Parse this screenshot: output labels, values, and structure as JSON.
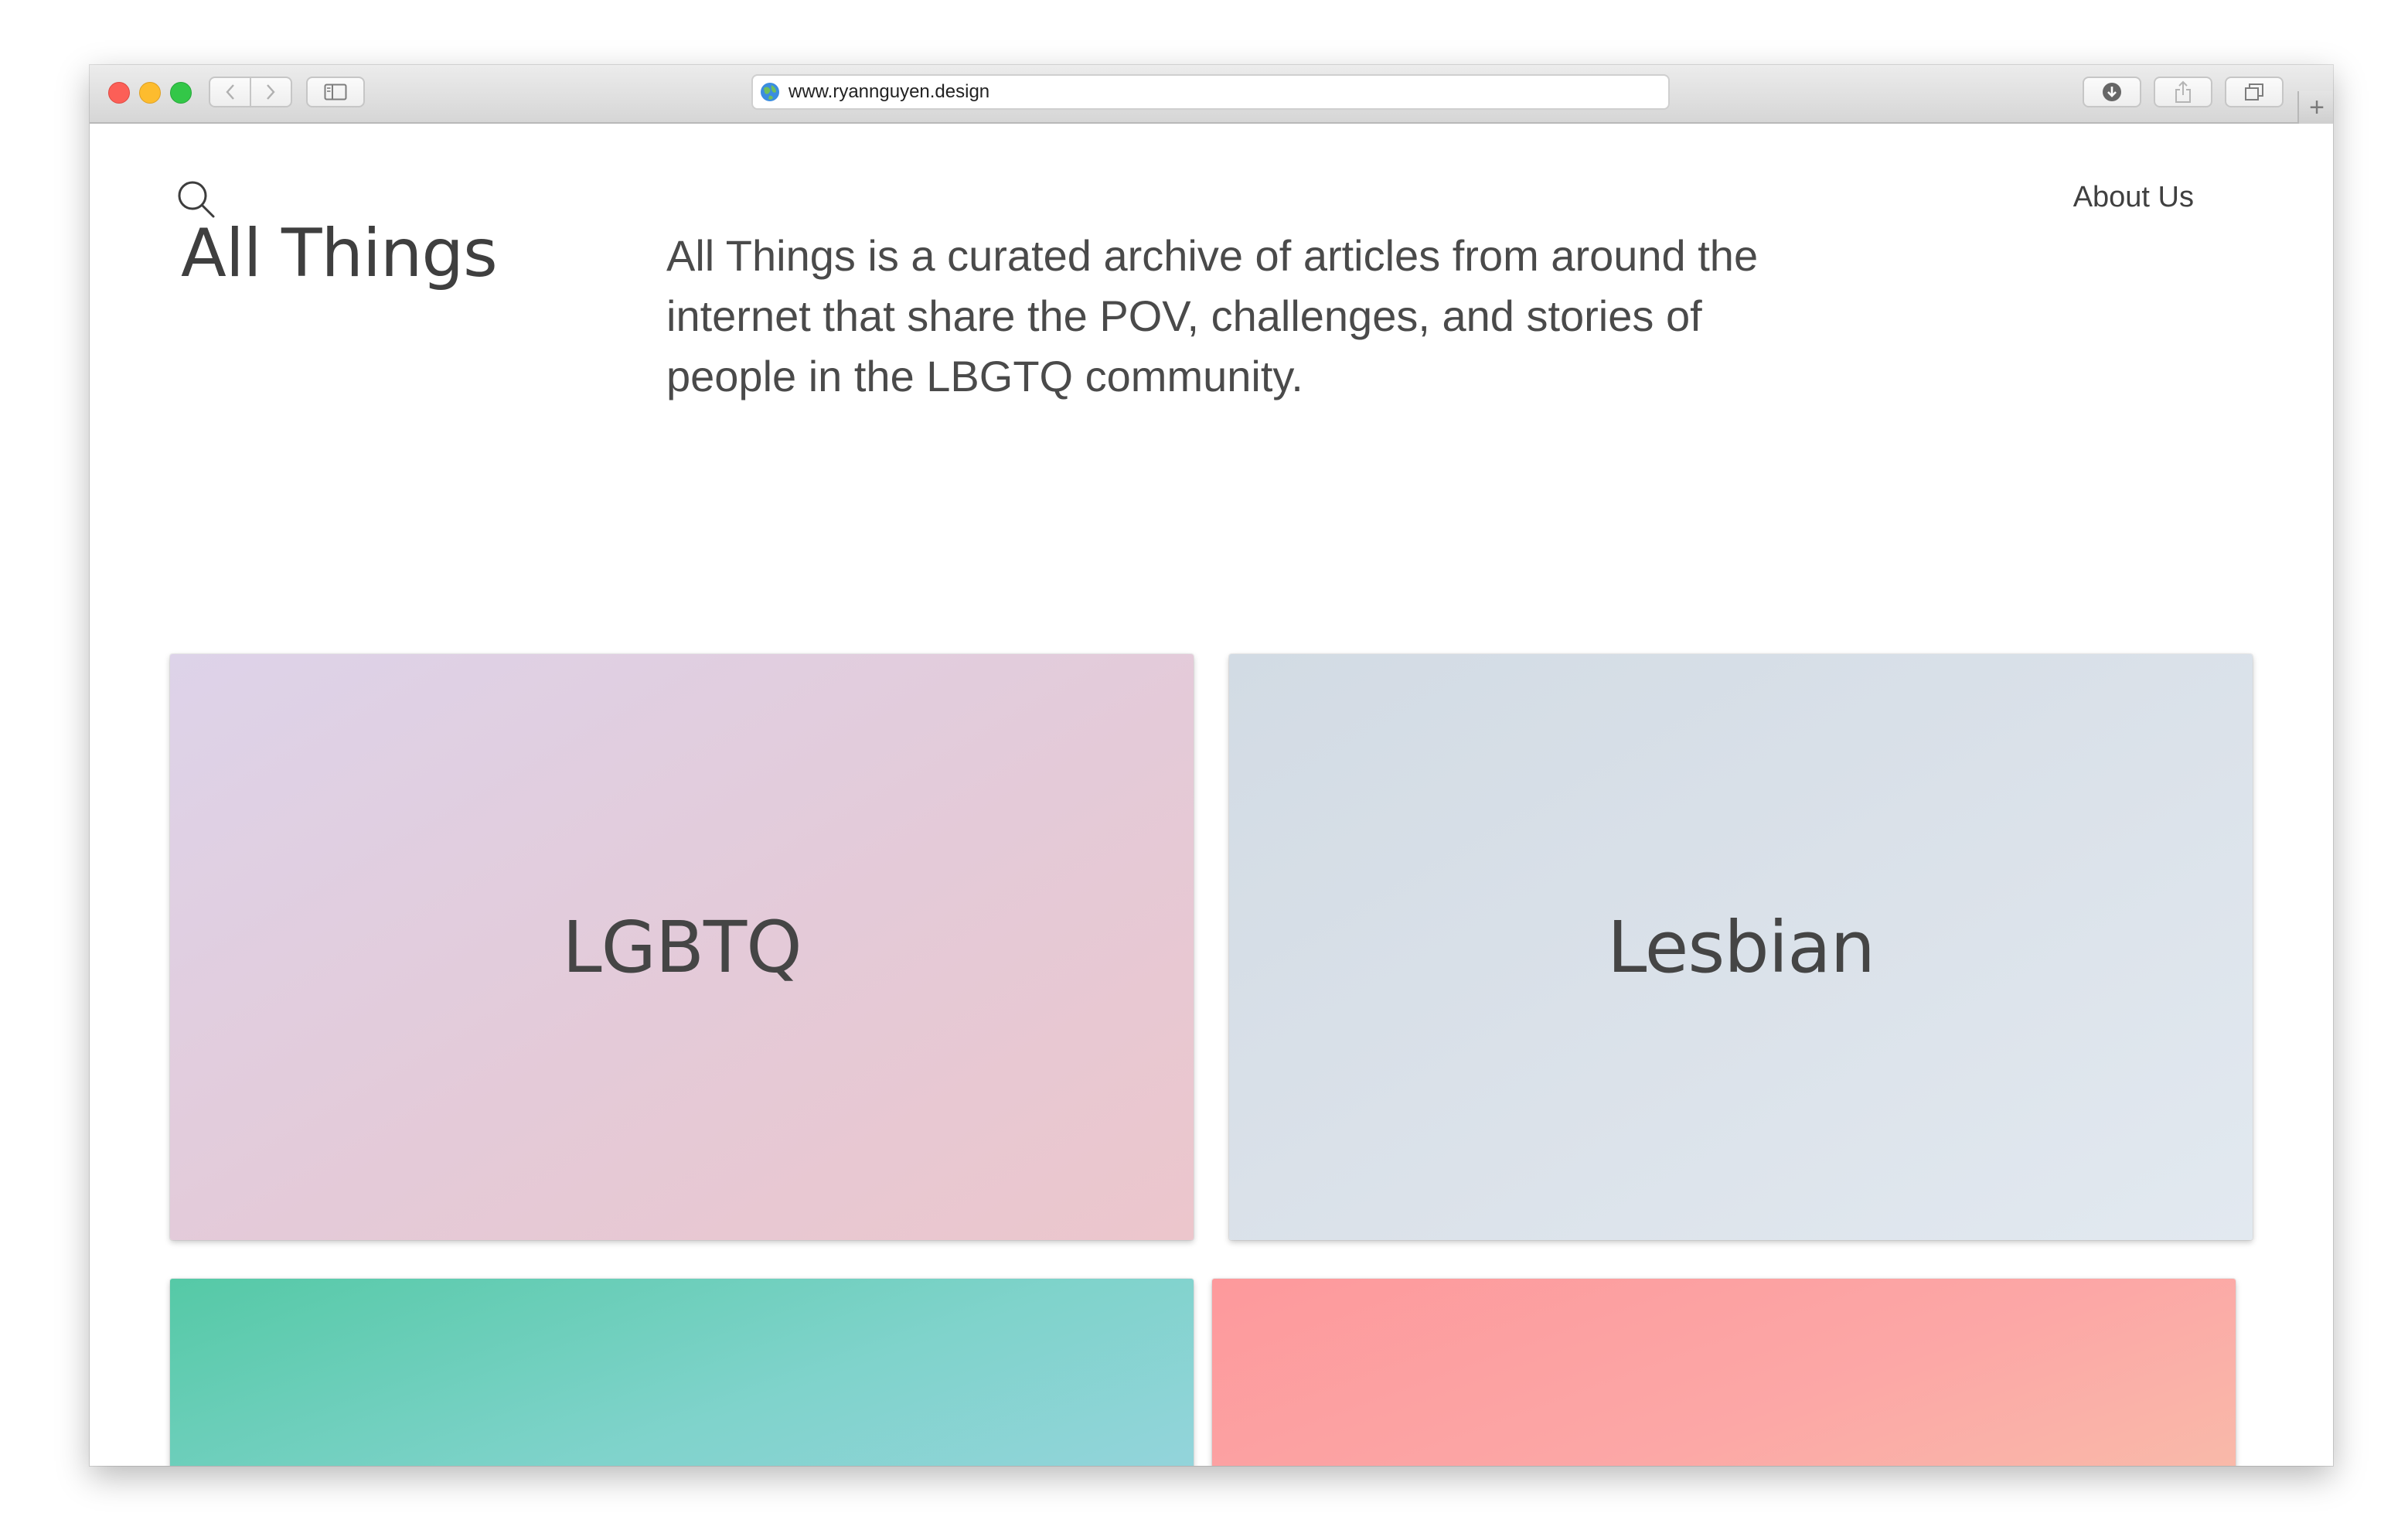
{
  "browser": {
    "url": "www.ryannguyen.design",
    "new_tab_label": "+"
  },
  "header": {
    "about_label": "About Us"
  },
  "hero": {
    "title": "All Things",
    "description": "All Things is a curated archive of articles from around the internet that share the POV, challenges, and stories of people in the LBGTQ community."
  },
  "categories": [
    {
      "label": "LGBTQ"
    },
    {
      "label": "Lesbian"
    }
  ],
  "colors": {
    "text_primary": "#3f3f3f",
    "card_lgbtq": [
      "#ddd3e9",
      "#ecc6cc"
    ],
    "card_lesbian": [
      "#d2dbe4",
      "#e2e9f0"
    ],
    "card_teal": [
      "#55c9a6",
      "#97d4de"
    ],
    "card_coral": [
      "#fd999c",
      "#f8bdaa"
    ]
  },
  "icons": {
    "search": "search-icon",
    "globe": "globe-icon",
    "back": "chevron-left-icon",
    "forward": "chevron-right-icon",
    "sidebar": "sidebar-icon",
    "download": "download-icon",
    "share": "share-icon",
    "tabs": "tabs-icon"
  }
}
